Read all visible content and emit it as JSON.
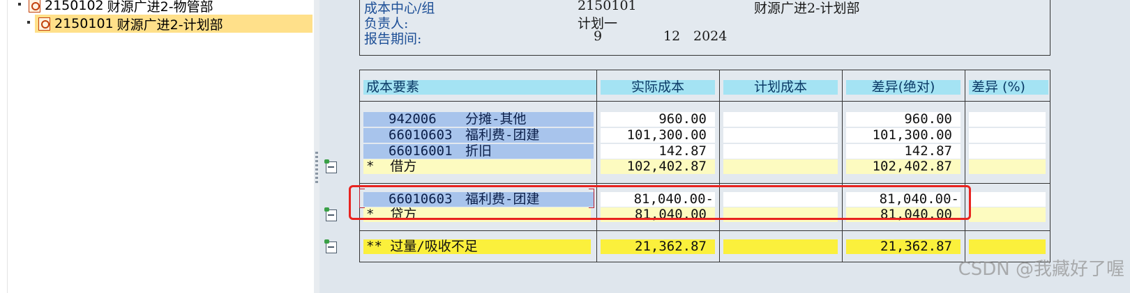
{
  "tree": {
    "items": [
      {
        "code": "2150102",
        "name": "财源广进2-物管部"
      },
      {
        "code": "2150101",
        "name": "财源广进2-计划部"
      }
    ]
  },
  "header": {
    "cost_center_label": "成本中心/组",
    "cost_center_code": "2150101",
    "cost_center_name": "财源广进2-计划部",
    "owner_label": "负责人:",
    "owner_value": "计划一",
    "period_label": "报告期间:",
    "period_from": "9",
    "period_to": "12",
    "period_year": "2024"
  },
  "columns": {
    "element": "成本要素",
    "actual": "实际成本",
    "plan": "计划成本",
    "variance_abs": "差异(绝对)",
    "variance_pct": "差异 (%)"
  },
  "debit_rows": [
    {
      "code": "942006",
      "name": "分摊-其他",
      "actual": "960.00",
      "plan": "",
      "variance": "960.00",
      "pct": ""
    },
    {
      "code": "66010603",
      "name": "福利费-团建",
      "actual": "101,300.00",
      "plan": "",
      "variance": "101,300.00",
      "pct": ""
    },
    {
      "code": "66016001",
      "name": "折旧",
      "actual": "142.87",
      "plan": "",
      "variance": "142.87",
      "pct": ""
    }
  ],
  "debit_total": {
    "label": "*  借方",
    "actual": "102,402.87",
    "variance": "102,402.87"
  },
  "credit_rows": [
    {
      "code": "66010603",
      "name": "福利费-团建",
      "actual": "81,040.00-",
      "plan": "",
      "variance": "81,040.00-",
      "pct": ""
    }
  ],
  "credit_total": {
    "label": "*  贷方",
    "actual": "81,040.00",
    "variance": "81,040.00"
  },
  "grand_total": {
    "label": "** 过量/吸收不足",
    "actual": "21,362.87",
    "variance": "21,362.87"
  },
  "watermark": "CSDN @我藏好了喔",
  "colors": {
    "header_cell": "#a4e3f3",
    "element_cell": "#a8c4ec",
    "total_light": "#fdfbc0",
    "total_strong": "#fbf03c",
    "annotation_box": "#e8231f"
  }
}
